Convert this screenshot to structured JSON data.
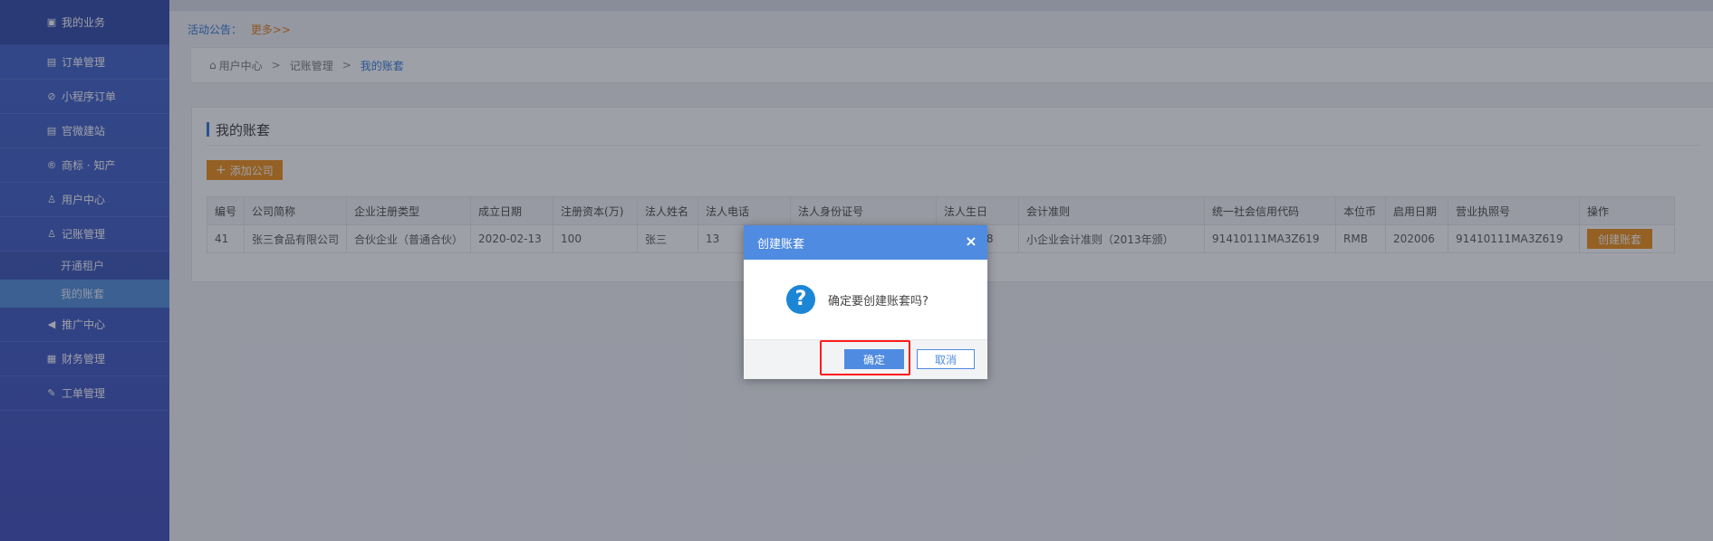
{
  "sidebar": {
    "items": [
      {
        "icon": "briefcase-icon",
        "glyph": "▣",
        "label": "我的业务"
      },
      {
        "icon": "document-icon",
        "glyph": "▤",
        "label": "订单管理"
      },
      {
        "icon": "mini-program-icon",
        "glyph": "⊘",
        "label": "小程序订单"
      },
      {
        "icon": "document-icon",
        "glyph": "▤",
        "label": "官微建站"
      },
      {
        "icon": "registered-icon",
        "glyph": "®",
        "label": "商标 · 知产"
      },
      {
        "icon": "user-icon",
        "glyph": "♙",
        "label": "用户中心"
      },
      {
        "icon": "user-icon",
        "glyph": "♙",
        "label": "记账管理"
      }
    ],
    "subitems": [
      {
        "label": "开通租户"
      },
      {
        "label": "我的账套"
      }
    ],
    "items_after": [
      {
        "icon": "megaphone-icon",
        "glyph": "◀",
        "label": "推广中心"
      },
      {
        "icon": "ledger-icon",
        "glyph": "▦",
        "label": "财务管理"
      },
      {
        "icon": "edit-icon",
        "glyph": "✎",
        "label": "工单管理"
      }
    ]
  },
  "notice": {
    "label": "活动公告：",
    "more": "更多>>"
  },
  "breadcrumb": {
    "home": "用户中心",
    "level2": "记账管理",
    "current": "我的账套",
    "sep": ">"
  },
  "panel": {
    "title": "我的账套",
    "add_button": "添加公司",
    "table": {
      "headers": [
        "编号",
        "公司简称",
        "企业注册类型",
        "成立日期",
        "注册资本(万)",
        "法人姓名",
        "法人电话",
        "法人身份证号",
        "法人生日",
        "会计准则",
        "统一社会信用代码",
        "本位币",
        "启用日期",
        "营业执照号",
        "操作"
      ],
      "rows": [
        {
          "cells": [
            "41",
            "张三食品有限公司",
            "合伙企业（普通合伙）",
            "2020-02-13",
            "100",
            "张三",
            "13",
            "",
            "80-05-08",
            "小企业会计准则（2013年颁）",
            "91410111MA3Z619",
            "RMB",
            "202006",
            "91410111MA3Z619"
          ],
          "action": "创建账套"
        }
      ]
    }
  },
  "dialog": {
    "title": "创建账套",
    "close": "×",
    "icon_glyph": "?",
    "message": "确定要创建账套吗?",
    "ok": "确定",
    "cancel": "取消"
  }
}
